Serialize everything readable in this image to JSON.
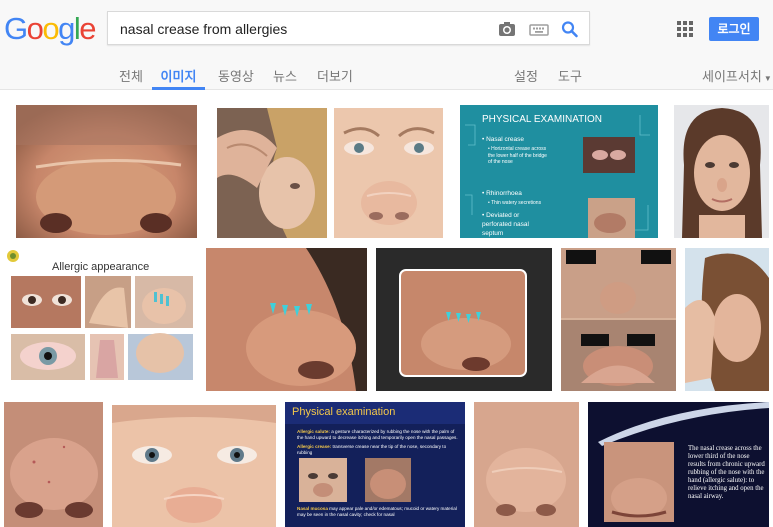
{
  "header": {
    "logo_letters": [
      "G",
      "o",
      "o",
      "g",
      "l",
      "e"
    ],
    "logo_colors": [
      "#4285f4",
      "#ea4335",
      "#fbbc05",
      "#4285f4",
      "#34a853",
      "#ea4335"
    ],
    "search": {
      "value": "nasal crease from allergies"
    },
    "icons": [
      "camera-icon",
      "keyboard-icon",
      "search-icon",
      "apps-grid-icon"
    ],
    "login_label": "로그인",
    "accent_color": "#4285f4"
  },
  "tabs": [
    {
      "label": "전체",
      "active": false
    },
    {
      "label": "이미지",
      "active": true
    },
    {
      "label": "동영상",
      "active": false
    },
    {
      "label": "뉴스",
      "active": false
    },
    {
      "label": "더보기",
      "active": false
    },
    {
      "label": "설정",
      "active": false
    },
    {
      "label": "도구",
      "active": false
    }
  ],
  "safesearch_label": "세이프서치",
  "results": {
    "physical_exam_1": {
      "title": "PHYSICAL EXAMINATION",
      "items": [
        "Nasal crease",
        "Horizontal crease across the lower half of the bridge of the nose",
        "Rhinorrhoea",
        "Thin watery secretions",
        "Deviated or perforated nasal septum"
      ]
    },
    "allergic_appearance": {
      "title": "Allergic appearance"
    },
    "physical_exam_2": {
      "title": "Physical examination",
      "items": [
        {
          "lead": "Allergic salute:",
          "text": " a gesture characterized by rubbing the nose with the palm of the hand upward to decrease itching and temporarily open the nasal passages."
        },
        {
          "lead": "Allergic crease:",
          "text": " transverse crease near the tip of the nose, secondary to rubbing"
        },
        {
          "lead": "Nasal mucosa",
          "text": " may appear pale and/or edematous; mucoid or watery material may be seen in the nasal cavity; check for nasal"
        }
      ]
    },
    "nasal_crease_caption": "The nasal crease across the lower third of the nose results from chronic upward rubbing of the nose with the hand (allergic salute): to relieve itching and open the nasal airway."
  }
}
